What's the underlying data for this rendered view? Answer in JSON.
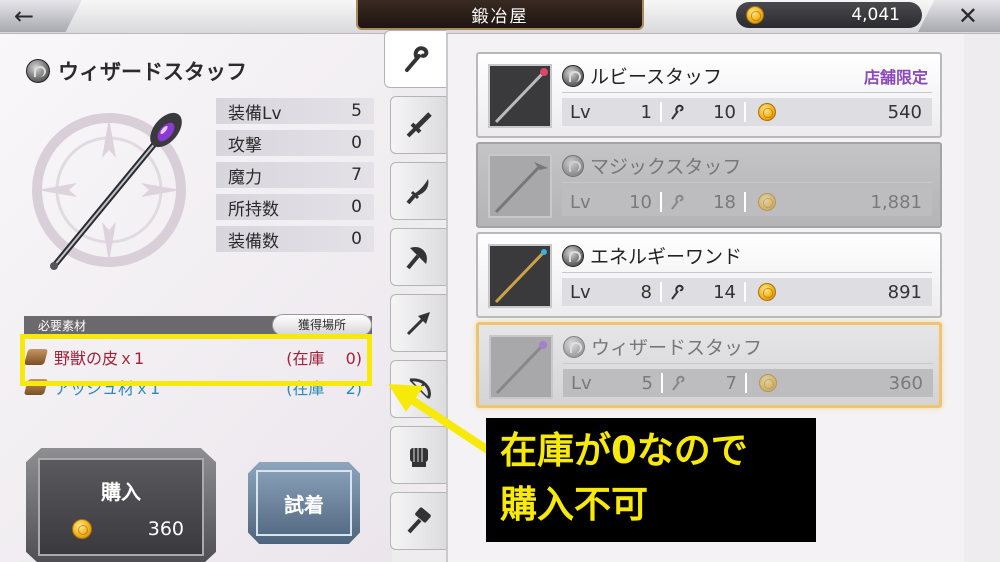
{
  "header": {
    "title": "鍛冶屋",
    "back_symbol": "←",
    "close_symbol": "✕",
    "currency": "4,041"
  },
  "item": {
    "name": "ウィザードスタッフ",
    "stats": [
      {
        "label": "装備Lv",
        "value": "5"
      },
      {
        "label": "攻撃",
        "value": "0"
      },
      {
        "label": "魔力",
        "value": "7"
      },
      {
        "label": "所持数",
        "value": "0"
      },
      {
        "label": "装備数",
        "value": "0"
      }
    ]
  },
  "materials": {
    "header": "必要素材",
    "source_button": "獲得場所",
    "rows": [
      {
        "name": "野獣の皮ｘ1",
        "stock": "(在庫　 0)"
      },
      {
        "name": "アッシュ材ｘ1",
        "stock": "(在庫　 2)"
      }
    ]
  },
  "actions": {
    "buy_label": "購入",
    "buy_price": "360",
    "try_label": "試着"
  },
  "tabs": [
    "staff-icon",
    "sword-icon",
    "blade-icon",
    "axe-icon",
    "spear-icon",
    "bow-icon",
    "fist-icon",
    "hammer-icon"
  ],
  "shop_items": [
    {
      "name": "ルビースタッフ",
      "badge": "店舗限定",
      "lv_label": "Lv",
      "lv": "1",
      "magic": "10",
      "price": "540",
      "state": "normal"
    },
    {
      "name": "マジックスタッフ",
      "badge": "",
      "lv_label": "Lv",
      "lv": "10",
      "magic": "18",
      "price": "1,881",
      "state": "dim"
    },
    {
      "name": "エネルギーワンド",
      "badge": "",
      "lv_label": "Lv",
      "lv": "8",
      "magic": "14",
      "price": "891",
      "state": "normal"
    },
    {
      "name": "ウィザードスタッフ",
      "badge": "",
      "lv_label": "Lv",
      "lv": "5",
      "magic": "7",
      "price": "360",
      "state": "selected"
    }
  ],
  "annotation": {
    "line1": "在庫が0なので",
    "line2": "購入不可"
  },
  "colors": {
    "highlight": "#f7ea0a",
    "shop_limit": "#8a4ab8",
    "material_missing": "#a0223a",
    "material_ok": "#2a8ab8"
  }
}
